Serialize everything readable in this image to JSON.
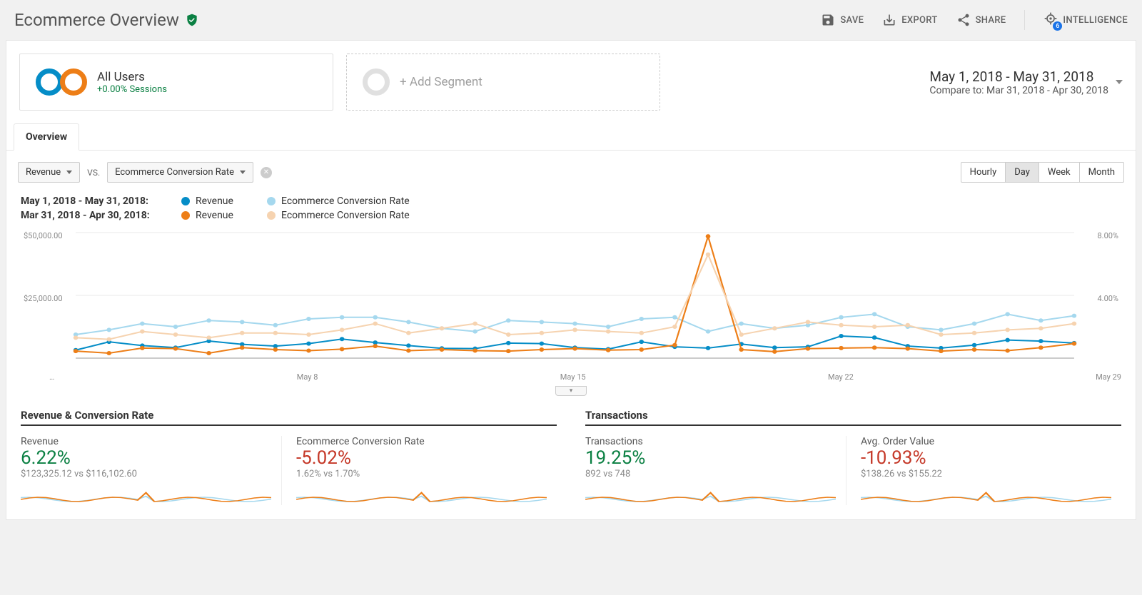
{
  "header": {
    "title": "Ecommerce Overview",
    "save": "SAVE",
    "export": "EXPORT",
    "share": "SHARE",
    "intelligence": "INTELLIGENCE",
    "intel_badge": "6"
  },
  "segment": {
    "title": "All Users",
    "sub": "+0.00% Sessions",
    "add": "+ Add Segment"
  },
  "date": {
    "primary": "May 1, 2018 - May 31, 2018",
    "compare_label": "Compare to: ",
    "compare_range": "Mar 31, 2018 - Apr 30, 2018"
  },
  "tabs": {
    "overview": "Overview"
  },
  "controls": {
    "metric_a": "Revenue",
    "vs": "VS.",
    "metric_b": "Ecommerce Conversion Rate",
    "gran": [
      "Hourly",
      "Day",
      "Week",
      "Month"
    ],
    "active_gran": "Day"
  },
  "legend": {
    "r1_range": "May 1, 2018 - May 31, 2018:",
    "r2_range": "Mar 31, 2018 - Apr 30, 2018:",
    "series_a": "Revenue",
    "series_b": "Ecommerce Conversion Rate",
    "colors": {
      "p_rev": "#058dc7",
      "p_conv": "#a5d8ee",
      "c_rev": "#ed7e17",
      "c_conv": "#f6d3b0"
    }
  },
  "chart_data": {
    "type": "line",
    "yticks_left": [
      "$50,000.00",
      "$25,000.00"
    ],
    "yticks_right": [
      "8.00%",
      "4.00%"
    ],
    "ylim_left": [
      0,
      50000
    ],
    "ylim_right": [
      0,
      8
    ],
    "x_ticks": [
      "…",
      "May 8",
      "May 15",
      "May 22",
      "May 29"
    ],
    "x": [
      1,
      2,
      3,
      4,
      5,
      6,
      7,
      8,
      9,
      10,
      11,
      12,
      13,
      14,
      15,
      16,
      17,
      18,
      19,
      20,
      21,
      22,
      23,
      24,
      25,
      26,
      27,
      28,
      29,
      30,
      31
    ],
    "series": [
      {
        "name": "Revenue (current)",
        "axis": "left",
        "color": "#058dc7",
        "values": [
          3200,
          6500,
          5000,
          4200,
          6800,
          5500,
          4800,
          5800,
          7600,
          6200,
          5000,
          3900,
          3800,
          6000,
          5800,
          4200,
          3600,
          6500,
          4500,
          4000,
          5600,
          4200,
          4500,
          8800,
          8200,
          4800,
          4000,
          5200,
          7200,
          6800,
          6000
        ]
      },
      {
        "name": "Ecommerce Conversion Rate (current)",
        "axis": "right",
        "color": "#a5d8ee",
        "values": [
          1.5,
          1.8,
          2.2,
          2.0,
          2.4,
          2.3,
          2.1,
          2.5,
          2.6,
          2.6,
          2.3,
          1.9,
          1.7,
          2.4,
          2.3,
          2.2,
          2.0,
          2.5,
          2.6,
          1.7,
          2.2,
          1.9,
          2.1,
          2.6,
          2.8,
          2.0,
          1.8,
          2.2,
          2.8,
          2.4,
          2.7
        ]
      },
      {
        "name": "Revenue (previous)",
        "axis": "left",
        "color": "#ed7e17",
        "values": [
          2800,
          2000,
          4000,
          3800,
          2000,
          4200,
          3400,
          3000,
          3600,
          4800,
          3000,
          3400,
          3000,
          2800,
          3400,
          3800,
          3200,
          3400,
          5200,
          48500,
          3400,
          2600,
          3800,
          4000,
          4200,
          3800,
          2800,
          3400,
          3000,
          4200,
          5800
        ]
      },
      {
        "name": "Ecommerce Conversion Rate (previous)",
        "axis": "right",
        "color": "#f6d3b0",
        "values": [
          1.3,
          1.2,
          1.7,
          1.5,
          1.3,
          1.6,
          1.6,
          1.5,
          1.8,
          2.2,
          1.6,
          1.9,
          2.2,
          1.5,
          1.6,
          1.8,
          1.7,
          1.6,
          2.0,
          6.6,
          1.5,
          1.9,
          2.3,
          2.1,
          2.0,
          2.1,
          1.5,
          1.6,
          1.8,
          1.9,
          2.2
        ]
      }
    ]
  },
  "metrics": {
    "group1_title": "Revenue & Conversion Rate",
    "group2_title": "Transactions",
    "items": [
      {
        "name": "Revenue",
        "pct": "6.22%",
        "positive": true,
        "detail": "$123,325.12 vs $116,102.60"
      },
      {
        "name": "Ecommerce Conversion Rate",
        "pct": "-5.02%",
        "positive": false,
        "detail": "1.62% vs 1.70%"
      },
      {
        "name": "Transactions",
        "pct": "19.25%",
        "positive": true,
        "detail": "892 vs 748"
      },
      {
        "name": "Avg. Order Value",
        "pct": "-10.93%",
        "positive": false,
        "detail": "$138.26 vs $155.22"
      }
    ]
  }
}
